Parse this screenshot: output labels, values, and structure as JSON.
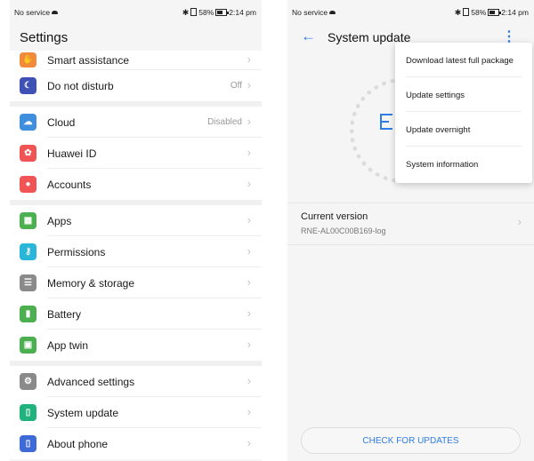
{
  "left": {
    "status": {
      "left": "No service",
      "right": "58%",
      "time": "2:14 pm"
    },
    "title": "Settings",
    "items": [
      {
        "label": "Smart assistance",
        "value": "",
        "icon": "hand-icon",
        "color": "#f28a3c"
      },
      {
        "label": "Do not disturb",
        "value": "Off",
        "icon": "moon-icon",
        "color": "#3f51b5"
      },
      {
        "label": "Cloud",
        "value": "Disabled",
        "icon": "cloud-icon",
        "color": "#3f8fde"
      },
      {
        "label": "Huawei ID",
        "value": "",
        "icon": "huawei-icon",
        "color": "#f05454"
      },
      {
        "label": "Accounts",
        "value": "",
        "icon": "person-icon",
        "color": "#f05454"
      },
      {
        "label": "Apps",
        "value": "",
        "icon": "apps-grid-icon",
        "color": "#4caf50"
      },
      {
        "label": "Permissions",
        "value": "",
        "icon": "key-icon",
        "color": "#29b6d9"
      },
      {
        "label": "Memory & storage",
        "value": "",
        "icon": "storage-icon",
        "color": "#8a8a8a"
      },
      {
        "label": "Battery",
        "value": "",
        "icon": "battery-icon",
        "color": "#4caf50"
      },
      {
        "label": "App twin",
        "value": "",
        "icon": "app-twin-icon",
        "color": "#4caf50"
      },
      {
        "label": "Advanced settings",
        "value": "",
        "icon": "gear-icon",
        "color": "#8a8a8a"
      },
      {
        "label": "System update",
        "value": "",
        "icon": "system-update-icon",
        "color": "#1fb27f"
      },
      {
        "label": "About phone",
        "value": "",
        "icon": "phone-icon",
        "color": "#3d6ad6"
      }
    ]
  },
  "right": {
    "status": {
      "left": "No service",
      "right": "58%",
      "time": "2:14 pm"
    },
    "title": "System update",
    "menu": [
      "Download latest full package",
      "Update settings",
      "Update overnight",
      "System information"
    ],
    "version": {
      "heading": "Current version",
      "value": "RNE-AL00C00B169-log"
    },
    "check_button": "CHECK FOR UPDATES"
  }
}
